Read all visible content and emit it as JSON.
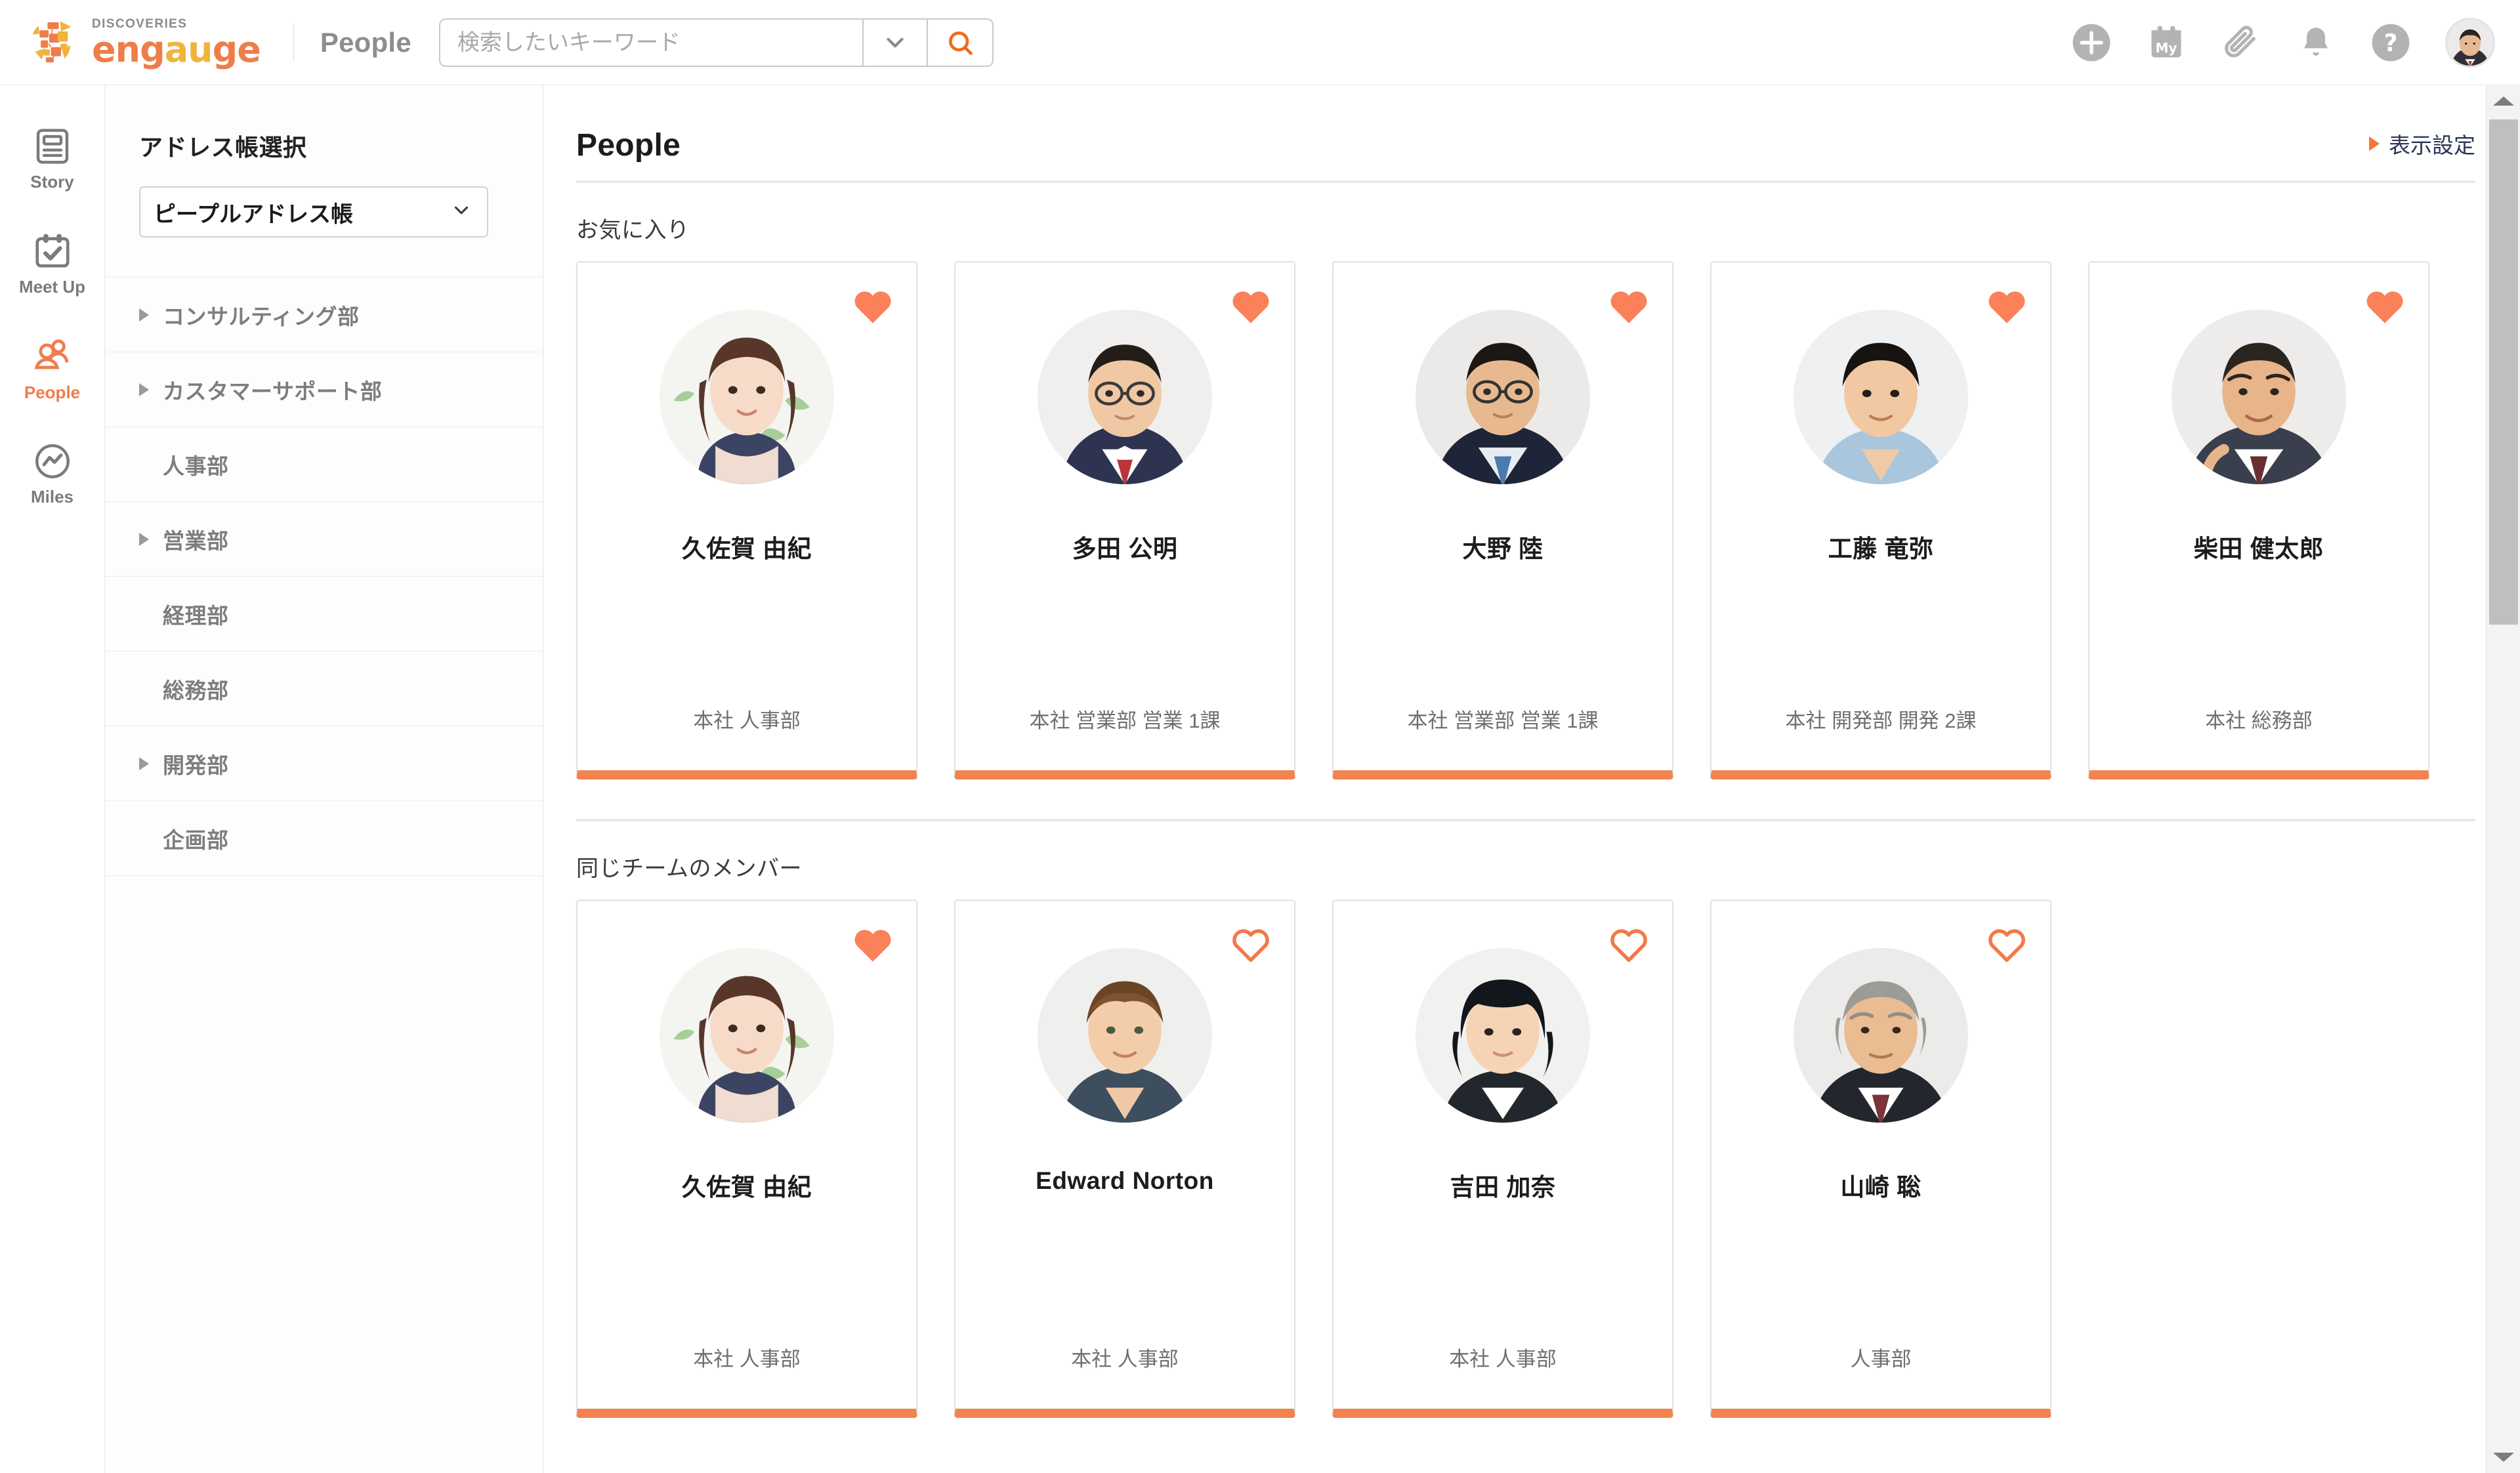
{
  "brand": {
    "sub": "DISCOVERIES",
    "word_parts": [
      {
        "t": "eng",
        "c": "#ef7d4a"
      },
      {
        "t": "a",
        "c": "#f0b43c"
      },
      {
        "t": "u",
        "c": "#f0b43c"
      },
      {
        "t": "ge",
        "c": "#ef7d4a"
      }
    ],
    "accent": "#f3834f",
    "accent_dark": "#ef7d4a",
    "accent_yellow": "#f0b43c",
    "heart_color": "#fa8159",
    "link_navy": "#2c3557"
  },
  "topbar": {
    "app_name": "People",
    "search": {
      "value": "",
      "placeholder": "検索したいキーワード",
      "dropdown_icon": "chevron-down-icon",
      "submit_icon": "search-icon"
    },
    "icons": [
      {
        "name": "add-icon",
        "label": "+"
      },
      {
        "name": "my-calendar-icon",
        "label": "My"
      },
      {
        "name": "attachment-icon",
        "label": ""
      },
      {
        "name": "notification-bell-icon",
        "label": ""
      },
      {
        "name": "help-icon",
        "label": "?"
      }
    ],
    "avatar_name": "user-avatar"
  },
  "rail": {
    "items": [
      {
        "label": "Story",
        "icon": "story-icon",
        "active": false
      },
      {
        "label": "Meet Up",
        "icon": "meetup-calendar-check-icon",
        "active": false
      },
      {
        "label": "People",
        "icon": "people-icon",
        "active": true
      },
      {
        "label": "Miles",
        "icon": "miles-chart-icon",
        "active": false
      }
    ]
  },
  "sidebar": {
    "title": "アドレス帳選択",
    "select": {
      "value": "ピープルアドレス帳",
      "caret": "chevron-down-icon"
    },
    "departments": [
      {
        "label": "コンサルティング部",
        "expandable": true
      },
      {
        "label": "カスタマーサポート部",
        "expandable": true
      },
      {
        "label": "人事部",
        "expandable": false
      },
      {
        "label": "営業部",
        "expandable": true
      },
      {
        "label": "経理部",
        "expandable": false
      },
      {
        "label": "総務部",
        "expandable": false
      },
      {
        "label": "開発部",
        "expandable": true
      },
      {
        "label": "企画部",
        "expandable": false
      }
    ]
  },
  "main": {
    "page_title": "People",
    "display_setting_label": "表示設定",
    "sections": [
      {
        "title": "お気に入り",
        "cards": [
          {
            "name": "久佐賀 由紀",
            "dept": "本社 人事部",
            "favorite": true,
            "avatar": "woman-brown-hair"
          },
          {
            "name": "多田 公明",
            "dept": "本社 営業部 営業 1課",
            "favorite": true,
            "avatar": "man-glasses-suit"
          },
          {
            "name": "大野 陸",
            "dept": "本社 営業部 営業 1課",
            "favorite": true,
            "avatar": "man-glasses-navy-suit"
          },
          {
            "name": "工藤 竜弥",
            "dept": "本社 開発部 開発 2課",
            "favorite": true,
            "avatar": "man-lightblue-shirt"
          },
          {
            "name": "柴田 健太郎",
            "dept": "本社 総務部",
            "favorite": true,
            "avatar": "older-man-suit"
          }
        ]
      },
      {
        "title": "同じチームのメンバー",
        "cards": [
          {
            "name": "久佐賀 由紀",
            "dept": "本社 人事部",
            "favorite": true,
            "avatar": "woman-brown-hair"
          },
          {
            "name": "Edward Norton",
            "dept": "本社 人事部",
            "favorite": false,
            "avatar": "man-western-brown-hair"
          },
          {
            "name": "吉田 加奈",
            "dept": "本社 人事部",
            "favorite": false,
            "avatar": "woman-black-bob"
          },
          {
            "name": "山崎 聡",
            "dept": "人事部",
            "favorite": false,
            "avatar": "senior-man-gray-hair"
          }
        ]
      }
    ]
  },
  "scrollbar": {
    "up_icon": "scroll-up-arrow-icon",
    "down_icon": "scroll-down-arrow-icon",
    "thumb": "scroll-thumb"
  }
}
